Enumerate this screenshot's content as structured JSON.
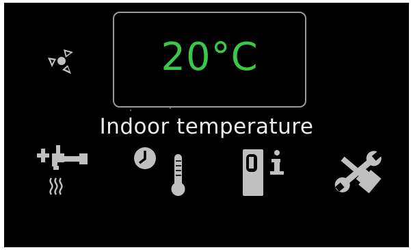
{
  "display": {
    "temperature": "20°C",
    "caption": "Indoor temperature"
  },
  "icons": {
    "fan": "fan-icon",
    "hot_water": "hot-water-tap-icon",
    "schedule": "clock-thermometer-icon",
    "device_info": "device-info-icon",
    "service": "hammer-wrench-icon"
  },
  "colors": {
    "background": "#000000",
    "value": "#39c84a",
    "caption": "#ececec",
    "icon": "#c0c0c0",
    "frame": "#9a9a9a"
  }
}
